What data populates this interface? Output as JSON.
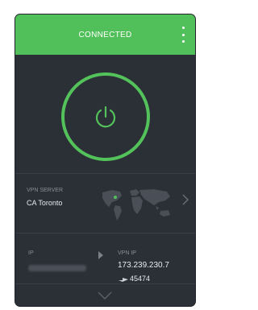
{
  "header": {
    "status": "CONNECTED",
    "menu_icon": "kebab-menu-icon",
    "color": "#52c05a"
  },
  "power": {
    "icon": "power-icon",
    "color": "#53c25a"
  },
  "server": {
    "label": "VPN SERVER",
    "value": "CA Toronto",
    "map_icon": "world-map-icon",
    "chevron_icon": "chevron-right-icon"
  },
  "ip": {
    "label": "IP",
    "value_hidden": "blurred"
  },
  "vpn_ip": {
    "label": "VPN IP",
    "value": "173.239.230.7",
    "port_icon": "port-forward-icon",
    "port": "45474"
  },
  "footer": {
    "expand_icon": "chevron-down-icon"
  },
  "colors": {
    "card_bg": "#2b2f36",
    "text_muted": "#8a8f97",
    "text_main": "#e9ebee"
  }
}
